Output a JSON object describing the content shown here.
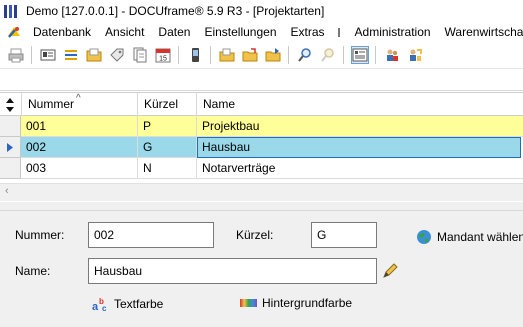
{
  "window": {
    "title": "Demo [127.0.0.1] - DOCUframe® 5.9 R3 - [Projektarten]"
  },
  "menu": {
    "items": [
      "Datenbank",
      "Ansicht",
      "Daten",
      "Einstellungen",
      "Extras",
      "Administration",
      "Warenwirtscha"
    ]
  },
  "toolbar": {
    "buttons": [
      "print-icon",
      "card-icon",
      "list-icon",
      "folder-icon",
      "tags-icon",
      "documents-icon",
      "calendar-icon",
      "phone-icon",
      "new-folder-icon",
      "open-folder-icon",
      "export-folder-icon",
      "search-icon",
      "search-disabled-icon",
      "form-view-icon",
      "users-icon",
      "user-settings-icon"
    ]
  },
  "grid": {
    "columns": {
      "nummer": "Nummer",
      "kuerzel": "Kürzel",
      "name": "Name"
    },
    "rows": [
      {
        "nummer": "001",
        "kuerzel": "P",
        "name": "Projektbau"
      },
      {
        "nummer": "002",
        "kuerzel": "G",
        "name": "Hausbau"
      },
      {
        "nummer": "003",
        "kuerzel": "N",
        "name": "Notarverträge"
      }
    ],
    "colors": {
      "row_highlight": "#ffff99",
      "row_selected": "#99d9ea",
      "cell_selected": "#3399dd"
    }
  },
  "form": {
    "nummer_label": "Nummer:",
    "nummer_value": "002",
    "kuerzel_label": "Kürzel:",
    "kuerzel_value": "G",
    "name_label": "Name:",
    "name_value": "Hausbau",
    "mandant_button": "Mandant wählen",
    "textfarbe_button": "Textfarbe",
    "hintergrundfarbe_button": "Hintergrundfarbe"
  }
}
